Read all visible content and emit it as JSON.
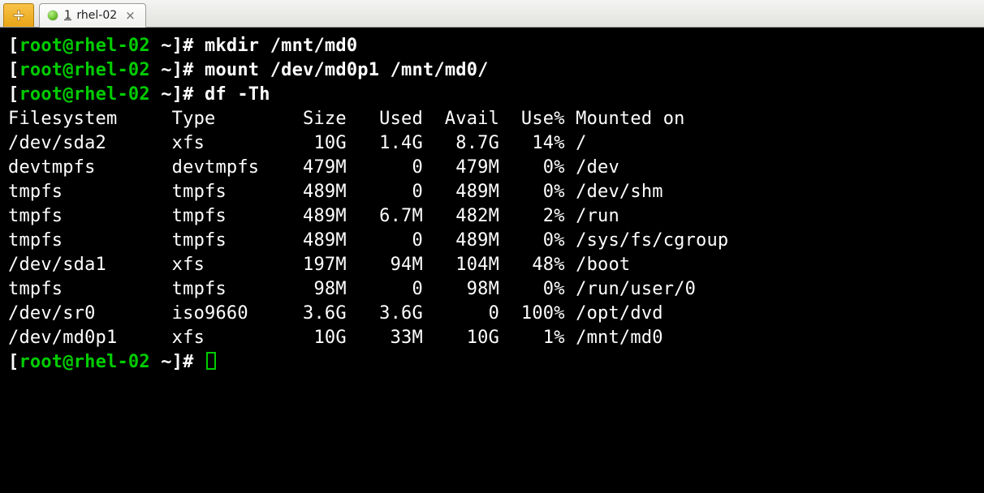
{
  "tab": {
    "index": "1",
    "title": "rhel-02"
  },
  "prompt": {
    "open": "[",
    "user_host": "root@rhel-02",
    "cwd": " ~",
    "close": "]# "
  },
  "commands": {
    "c1": "mkdir /mnt/md0",
    "c2": "mount /dev/md0p1 /mnt/md0/",
    "c3": "df -Th"
  },
  "df": {
    "header": {
      "fs": "Filesystem",
      "type": "Type",
      "size": "Size",
      "used": "Used",
      "avail": "Avail",
      "usep": "Use%",
      "mnt": "Mounted on"
    },
    "rows": [
      {
        "fs": "/dev/sda2",
        "type": "xfs",
        "size": "10G",
        "used": "1.4G",
        "avail": "8.7G",
        "usep": "14%",
        "mnt": "/"
      },
      {
        "fs": "devtmpfs",
        "type": "devtmpfs",
        "size": "479M",
        "used": "0",
        "avail": "479M",
        "usep": "0%",
        "mnt": "/dev"
      },
      {
        "fs": "tmpfs",
        "type": "tmpfs",
        "size": "489M",
        "used": "0",
        "avail": "489M",
        "usep": "0%",
        "mnt": "/dev/shm"
      },
      {
        "fs": "tmpfs",
        "type": "tmpfs",
        "size": "489M",
        "used": "6.7M",
        "avail": "482M",
        "usep": "2%",
        "mnt": "/run"
      },
      {
        "fs": "tmpfs",
        "type": "tmpfs",
        "size": "489M",
        "used": "0",
        "avail": "489M",
        "usep": "0%",
        "mnt": "/sys/fs/cgroup"
      },
      {
        "fs": "/dev/sda1",
        "type": "xfs",
        "size": "197M",
        "used": "94M",
        "avail": "104M",
        "usep": "48%",
        "mnt": "/boot"
      },
      {
        "fs": "tmpfs",
        "type": "tmpfs",
        "size": "98M",
        "used": "0",
        "avail": "98M",
        "usep": "0%",
        "mnt": "/run/user/0"
      },
      {
        "fs": "/dev/sr0",
        "type": "iso9660",
        "size": "3.6G",
        "used": "3.6G",
        "avail": "0",
        "usep": "100%",
        "mnt": "/opt/dvd"
      },
      {
        "fs": "/dev/md0p1",
        "type": "xfs",
        "size": "10G",
        "used": "33M",
        "avail": "10G",
        "usep": "1%",
        "mnt": "/mnt/md0"
      }
    ]
  },
  "columns": {
    "fs": 13,
    "type": 10,
    "size": 5,
    "used": 6,
    "avail": 6,
    "usep": 5
  }
}
